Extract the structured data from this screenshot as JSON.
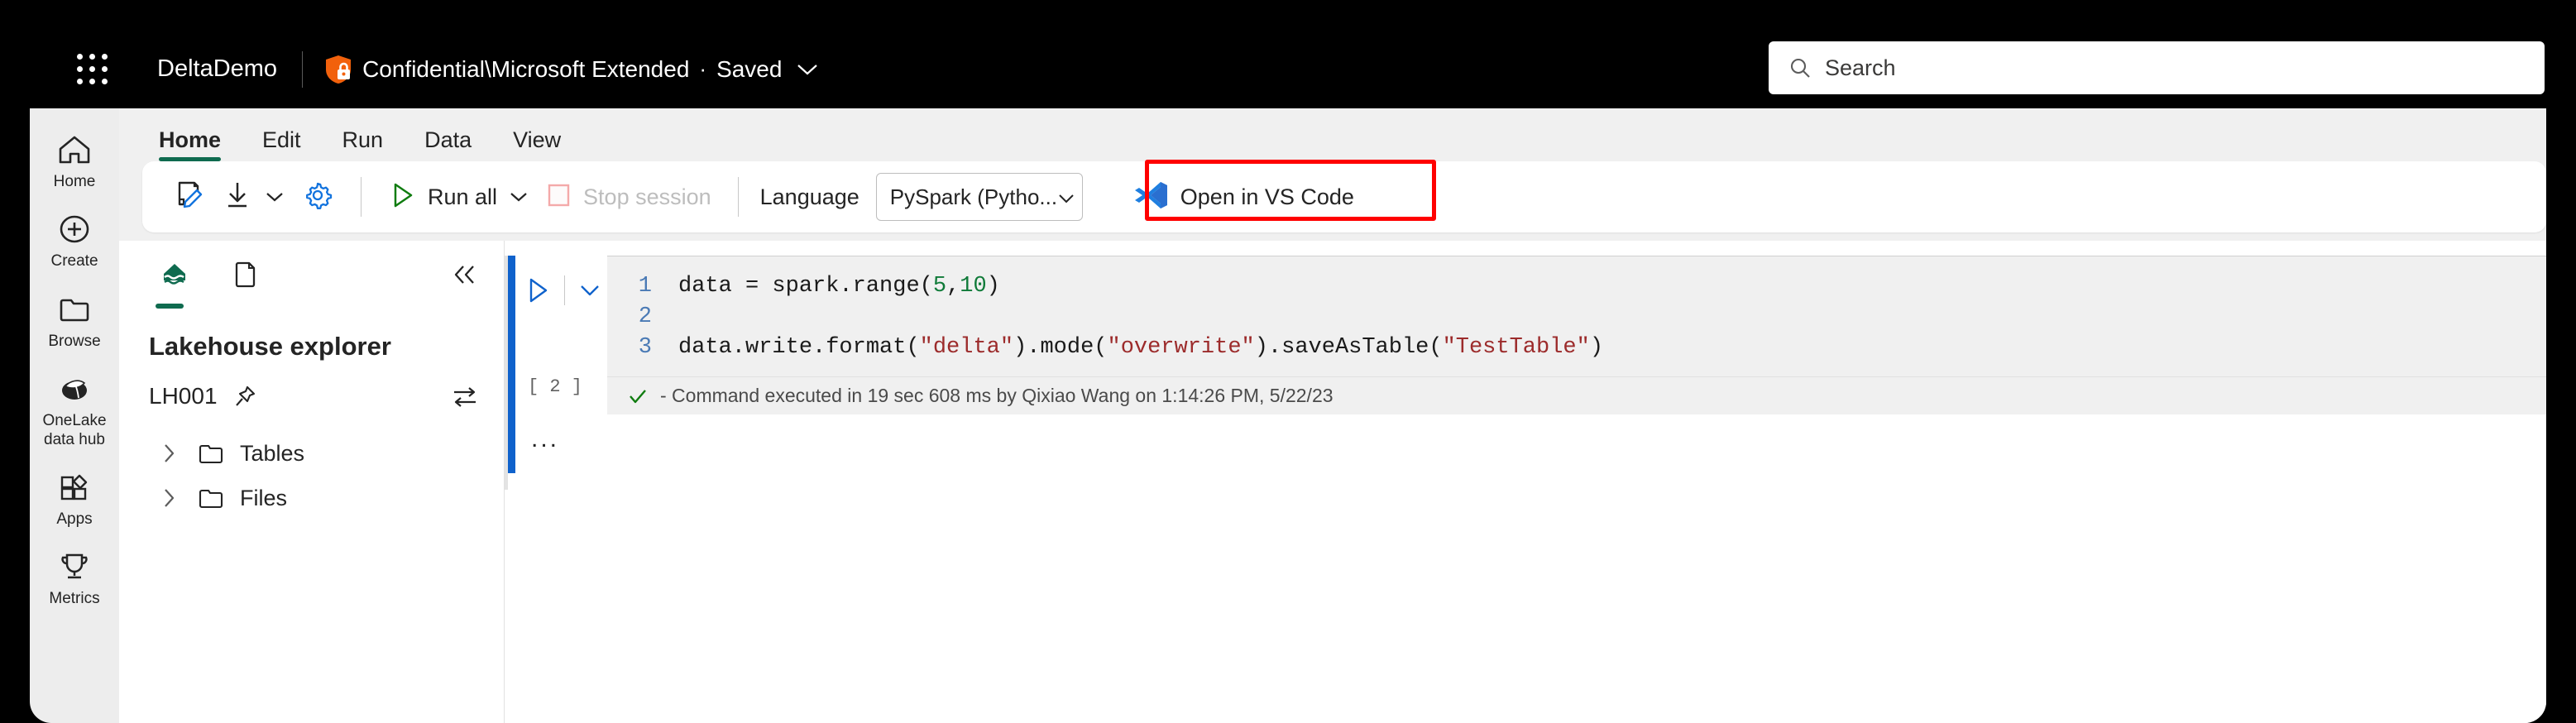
{
  "header": {
    "waffle_icon": "waffle-grid-icon",
    "app_title": "DeltaDemo",
    "sensitivity_icon": "shield-lock-icon",
    "sensitivity_label": "Confidential\\Microsoft Extended",
    "separator_dot": "·",
    "save_status": "Saved",
    "save_chevron_icon": "chevron-down-icon"
  },
  "search": {
    "icon": "search-icon",
    "placeholder": "Search",
    "value": ""
  },
  "rail": {
    "items": [
      {
        "icon": "home-icon",
        "label": "Home"
      },
      {
        "icon": "plus-circle-icon",
        "label": "Create"
      },
      {
        "icon": "folder-icon",
        "label": "Browse"
      },
      {
        "icon": "onelake-icon",
        "label": "OneLake\ndata hub",
        "line1": "OneLake",
        "line2": "data hub"
      },
      {
        "icon": "apps-grid-icon",
        "label": "Apps"
      },
      {
        "icon": "trophy-icon",
        "label": "Metrics"
      }
    ]
  },
  "ribbon": {
    "tabs": [
      {
        "label": "Home",
        "active": true
      },
      {
        "label": "Edit",
        "active": false
      },
      {
        "label": "Run",
        "active": false
      },
      {
        "label": "Data",
        "active": false
      },
      {
        "label": "View",
        "active": false
      }
    ],
    "active_underline_color": "#0f6b4f"
  },
  "toolbar": {
    "markdown_icon": "page-edit-icon",
    "import_icon": "arrow-download-icon",
    "import_chevron_icon": "chevron-down-icon",
    "settings_icon": "gear-icon",
    "run_all_icon": "play-triangle-icon",
    "run_all_label": "Run all",
    "run_all_chevron_icon": "chevron-down-icon",
    "stop_session_icon": "stop-square-icon",
    "stop_session_label": "Stop session",
    "stop_session_disabled": true,
    "language_label": "Language",
    "language_value": "PySpark (Pytho...",
    "language_chevron_icon": "chevron-down-icon",
    "vscode_icon": "vscode-logo-icon",
    "vscode_label": "Open in VS Code",
    "annotation_color": "#ff0000"
  },
  "explorer": {
    "tab_lakehouse_icon": "lakehouse-icon",
    "tab_notebook_icon": "document-icon",
    "collapse_icon": "chevron-double-left-icon",
    "title": "Lakehouse explorer",
    "lakehouse_name": "LH001",
    "pin_icon": "pin-icon",
    "swap_icon": "switch-arrows-icon",
    "tree": [
      {
        "chevron_icon": "chevron-right-icon",
        "folder_icon": "folder-icon",
        "label": "Tables"
      },
      {
        "chevron_icon": "chevron-right-icon",
        "folder_icon": "folder-icon",
        "label": "Files"
      }
    ]
  },
  "notebook": {
    "cell": {
      "run_icon": "play-triangle-icon",
      "collapse_icon": "chevron-down-icon",
      "execution_count": "[ 2 ]",
      "more_options": "...",
      "accent_color": "#0f62cc",
      "lines": [
        {
          "number": "1",
          "tokens": [
            {
              "t": "data = spark.range(",
              "k": "plain"
            },
            {
              "t": "5",
              "k": "num"
            },
            {
              "t": ",",
              "k": "plain"
            },
            {
              "t": "10",
              "k": "num"
            },
            {
              "t": ")",
              "k": "plain"
            }
          ]
        },
        {
          "number": "2",
          "tokens": [
            {
              "t": "",
              "k": "plain"
            }
          ]
        },
        {
          "number": "3",
          "tokens": [
            {
              "t": "data.write.format(",
              "k": "plain"
            },
            {
              "t": "\"delta\"",
              "k": "str"
            },
            {
              "t": ").mode(",
              "k": "plain"
            },
            {
              "t": "\"overwrite\"",
              "k": "str"
            },
            {
              "t": ").saveAsTable(",
              "k": "plain"
            },
            {
              "t": "\"TestTable\"",
              "k": "str"
            },
            {
              "t": ")",
              "k": "plain"
            }
          ]
        }
      ],
      "status_icon": "checkmark-icon",
      "status_text": "- Command executed in 19 sec 608 ms by Qixiao Wang on 1:14:26 PM, 5/22/23"
    }
  }
}
